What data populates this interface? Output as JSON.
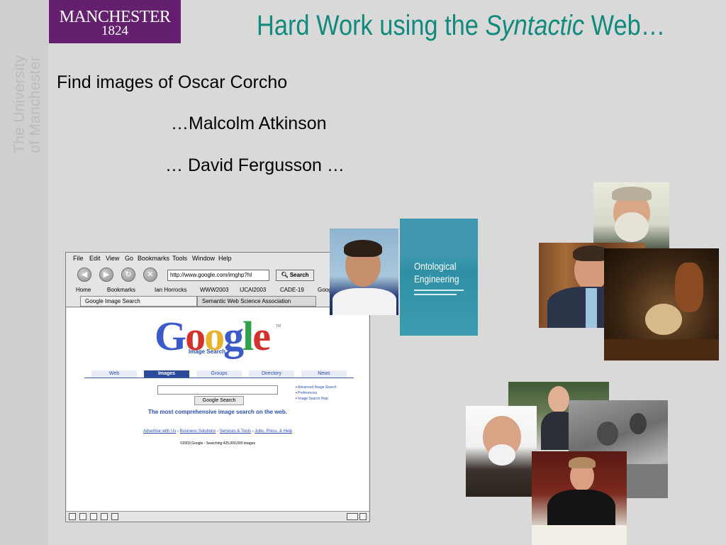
{
  "header": {
    "logo_name": "MANCHESTER",
    "logo_year": "1824",
    "title_prefix": "Hard Work using the ",
    "title_emphasis": "Syntactic",
    "title_suffix": " Web…"
  },
  "sidebar": {
    "line1": "The University",
    "line2": "of Manchester"
  },
  "content": {
    "line1": "Find images of Oscar Corcho",
    "line2": "…Malcolm Atkinson",
    "line3": "… David Fergusson …"
  },
  "browser": {
    "menu": [
      "File",
      "Edit",
      "View",
      "Go",
      "Bookmarks",
      "Tools",
      "Window",
      "Help"
    ],
    "url": "http://www.google.com/imghp?hl",
    "search_label": "Search",
    "bookmarks": [
      "Home",
      "Bookmarks",
      "Ian Horrocks",
      "WWW2003",
      "IJCAI2003",
      "CADE-19",
      "Goog"
    ],
    "tabs": [
      "Google Image Search",
      "Semantic Web Science Association"
    ],
    "google": {
      "logo_letters": [
        "G",
        "o",
        "o",
        "g",
        "l",
        "e"
      ],
      "logo_sub": "Image Search",
      "logo_tm": "TM",
      "nav_tabs": [
        "Web",
        "Images",
        "Groups",
        "Directory",
        "News"
      ],
      "active_tab": "Images",
      "search_button": "Google Search",
      "side_links": [
        "Advanced Image Search",
        "Preferences",
        "Image Search Help"
      ],
      "tagline": "The most comprehensive image search on the web.",
      "footer_links": [
        "Advertise with Us",
        "Business Solutions",
        "Services & Tools",
        "Jobs, Press, & Help"
      ],
      "copyright": "©2003 Google - Searching 425,000,000 images"
    }
  },
  "book": {
    "title_line1": "Ontological",
    "title_line2": "Engineering"
  },
  "colors": {
    "title": "#0f8a7d",
    "logo_background": "#64206f",
    "slide_background": "#d9d9d9"
  }
}
